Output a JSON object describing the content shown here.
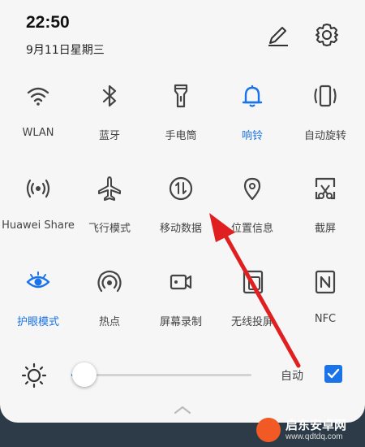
{
  "status": {
    "time": "22:50",
    "date": "9月11日星期三"
  },
  "header": {
    "edit_icon": "pencil-icon",
    "settings_icon": "gear-icon"
  },
  "tiles": [
    {
      "label": "WLAN",
      "icon": "wifi-icon",
      "active": false
    },
    {
      "label": "蓝牙",
      "icon": "bluetooth-icon",
      "active": false
    },
    {
      "label": "手电筒",
      "icon": "flashlight-icon",
      "active": false
    },
    {
      "label": "响铃",
      "icon": "bell-icon",
      "active": true
    },
    {
      "label": "自动旋转",
      "icon": "rotate-icon",
      "active": false
    },
    {
      "label": "Huawei Share",
      "icon": "huawei-share-icon",
      "active": false
    },
    {
      "label": "飞行模式",
      "icon": "airplane-icon",
      "active": false
    },
    {
      "label": "移动数据",
      "icon": "mobile-data-icon",
      "active": false
    },
    {
      "label": "位置信息",
      "icon": "location-icon",
      "active": false
    },
    {
      "label": "截屏",
      "icon": "screenshot-icon",
      "active": false
    },
    {
      "label": "护眼模式",
      "icon": "eye-icon",
      "active": true
    },
    {
      "label": "热点",
      "icon": "hotspot-icon",
      "active": false
    },
    {
      "label": "屏幕录制",
      "icon": "screen-record-icon",
      "active": false
    },
    {
      "label": "无线投屏",
      "icon": "wireless-projection-icon",
      "active": false
    },
    {
      "label": "NFC",
      "icon": "nfc-icon",
      "active": false
    }
  ],
  "brightness": {
    "level": 0.07,
    "auto_label": "自动",
    "auto_enabled": true
  },
  "colors": {
    "accent": "#1a73e8",
    "arrow": "#e02020"
  },
  "watermark": {
    "title": "启东安卓网",
    "url": "www.qdtdq.com"
  }
}
